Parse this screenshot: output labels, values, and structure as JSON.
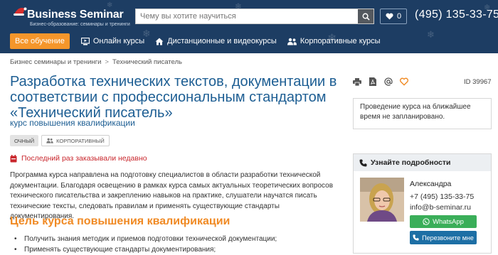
{
  "brand": {
    "name": "Business Seminar",
    "tagline": "Бизнес-образование: семинары и тренинги"
  },
  "search": {
    "placeholder": "Чему вы хотите научиться"
  },
  "favorites": {
    "count": "0"
  },
  "header_phone": "(495) 135-33-75",
  "nav": {
    "items": [
      {
        "label": "Все обучение",
        "icon": "none"
      },
      {
        "label": "Онлайн курсы",
        "icon": "online-icon"
      },
      {
        "label": "Дистанционные и видеокурсы",
        "icon": "home-icon"
      },
      {
        "label": "Корпоративные курсы",
        "icon": "people-icon"
      }
    ]
  },
  "breadcrumb": {
    "items": [
      "Бизнес семинары и тренинги",
      "Технический писатель"
    ],
    "separator": ">"
  },
  "course": {
    "title": "Разработка технических текстов, документации в соответствии с профессиональным стандартом «Технический писатель»",
    "subtitle": "курс повышения квалификации",
    "tags": [
      "ОЧНЫЙ",
      "КОРПОРАТИВНЫЙ"
    ],
    "last_ordered": "Последний раз заказывали недавно",
    "description": "Программа курса направлена на подготовку специалистов в области разработки технической документации. Благодаря освещению в рамках курса самых актуальных теоретических вопросов технического писательства и закреплению навыков на практике, слушатели научатся писать технические тексты, следовать правилам и применять существующие стандарты документирования.",
    "goal_heading": "Цель курса повышения квалификации",
    "goals": [
      "Получить знания методик и приемов подготовки технической документации;",
      "Применять существующие стандарты документирования;"
    ],
    "id_label": "ID 39967"
  },
  "notice": "Проведение курса на ближайшее время не запланировано.",
  "contact": {
    "heading": "Узнайте подробности",
    "name": "Александра",
    "phone": "+7 (495) 135-33-75",
    "email": "info@b-seminar.ru",
    "whatsapp_label": "WhatsApp",
    "callback_label": "Перезвоните мне"
  },
  "colors": {
    "header_bg": "#1d3d63",
    "accent_orange": "#f5962b",
    "title_blue": "#1d5e93",
    "alert_red": "#c9272d",
    "whatsapp_green": "#3aae59",
    "callback_blue": "#1d6fa5"
  }
}
